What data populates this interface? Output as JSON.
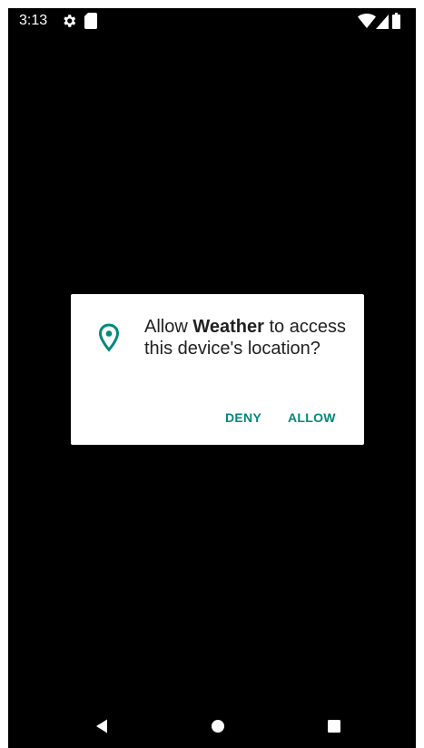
{
  "status_bar": {
    "time": "3:13",
    "icons": [
      "settings-gear-icon",
      "sd-card-icon",
      "wifi-icon",
      "cell-signal-icon",
      "battery-icon"
    ]
  },
  "dialog": {
    "message_prefix": "Allow ",
    "app_name": "Weather",
    "message_suffix": " to access this device's location?",
    "icon": "location-pin-icon",
    "deny_label": "DENY",
    "allow_label": "ALLOW"
  },
  "nav_bar": {
    "buttons": [
      "back-icon",
      "home-icon",
      "recents-icon"
    ]
  },
  "colors": {
    "accent": "#00897b",
    "background": "#000000",
    "dialog_bg": "#ffffff",
    "text": "#212121"
  }
}
